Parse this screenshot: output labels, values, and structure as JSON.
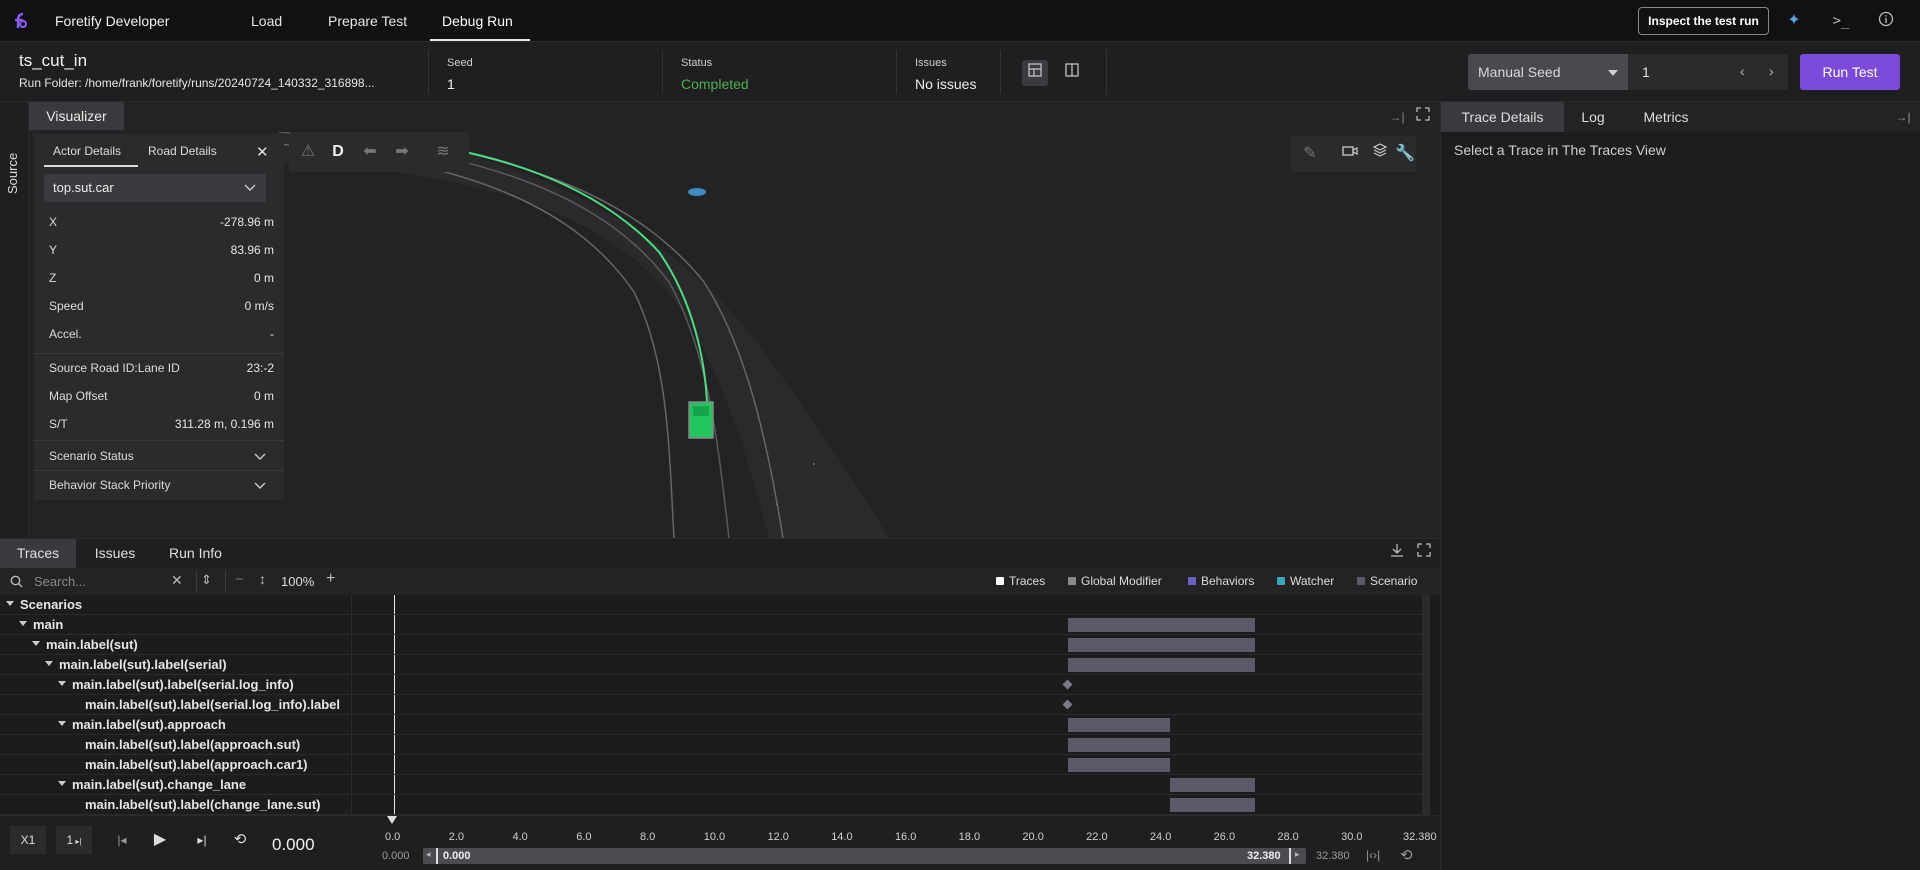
{
  "nav": {
    "app_name": "Foretify Developer",
    "tabs": [
      "Load",
      "Prepare Test",
      "Debug Run"
    ],
    "active_tab": "Debug Run",
    "inspect_button": "Inspect the test run"
  },
  "header": {
    "test_name": "ts_cut_in",
    "run_folder_label": "Run Folder:",
    "run_folder": "/home/frank/foretify/runs/20240724_140332_316898...",
    "seed_label": "Seed",
    "seed_value": "1",
    "status_label": "Status",
    "status_value": "Completed",
    "status_color": "#4caf50",
    "issues_label": "Issues",
    "issues_value": "No issues",
    "seed_mode": "Manual Seed",
    "seed_input": "1",
    "run_button": "Run Test",
    "run_button_color": "#7b4ad8"
  },
  "source_label": "Source",
  "visualizer": {
    "tab": "Visualizer",
    "mode_letter": "D"
  },
  "actor_panel": {
    "tabs": [
      "Actor Details",
      "Road Details"
    ],
    "selected_actor": "top.sut.car",
    "rows": [
      {
        "k": "X",
        "v": "-278.96 m"
      },
      {
        "k": "Y",
        "v": "83.96 m"
      },
      {
        "k": "Z",
        "v": "0 m"
      },
      {
        "k": "Speed",
        "v": "0 m/s"
      },
      {
        "k": "Accel.",
        "v": "-"
      }
    ],
    "rows2": [
      {
        "k": "Source Road ID:Lane ID",
        "v": "23:-2"
      },
      {
        "k": "Map Offset",
        "v": "0 m"
      },
      {
        "k": "S/T",
        "v": "311.28 m, 0.196 m"
      }
    ],
    "sections": [
      "Scenario Status",
      "Behavior Stack Priority"
    ]
  },
  "right_panel": {
    "tabs": [
      "Trace Details",
      "Log",
      "Metrics"
    ],
    "empty_message": "Select a Trace in The Traces View"
  },
  "traces": {
    "tabs": [
      "Traces",
      "Issues",
      "Run Info"
    ],
    "search_placeholder": "Search...",
    "zoom": "100%",
    "legend": [
      {
        "label": "Traces",
        "color": "#ffffff"
      },
      {
        "label": "Global Modifier",
        "color": "#8a8a8a"
      },
      {
        "label": "Behaviors",
        "color": "#6b62c9"
      },
      {
        "label": "Watcher",
        "color": "#3aa6b9"
      },
      {
        "label": "Scenario",
        "color": "#5a5a68"
      }
    ],
    "tree": [
      {
        "label": "Scenarios",
        "depth": 0,
        "expanded": true
      },
      {
        "label": "main",
        "depth": 1,
        "expanded": true
      },
      {
        "label": "main.label(sut)",
        "depth": 2,
        "expanded": true
      },
      {
        "label": "main.label(sut).label(serial)",
        "depth": 3,
        "expanded": true
      },
      {
        "label": "main.label(sut).label(serial.log_info)",
        "depth": 4,
        "expanded": true
      },
      {
        "label": "main.label(sut).label(serial.log_info).label",
        "depth": 5,
        "expanded": false
      },
      {
        "label": "main.label(sut).approach",
        "depth": 4,
        "expanded": true
      },
      {
        "label": "main.label(sut).label(approach.sut)",
        "depth": 5,
        "expanded": false
      },
      {
        "label": "main.label(sut).label(approach.car1)",
        "depth": 5,
        "expanded": false
      },
      {
        "label": "main.label(sut).change_lane",
        "depth": 4,
        "expanded": true
      },
      {
        "label": "main.label(sut).label(change_lane.sut)",
        "depth": 5,
        "expanded": false
      }
    ],
    "spans": [
      null,
      {
        "start": 21.3,
        "end": 27.2
      },
      {
        "start": 21.3,
        "end": 27.2
      },
      {
        "start": 21.3,
        "end": 27.2
      },
      {
        "point": 21.3
      },
      {
        "point": 21.3
      },
      {
        "start": 21.3,
        "end": 24.5
      },
      {
        "start": 21.3,
        "end": 24.5
      },
      {
        "start": 21.3,
        "end": 24.5
      },
      {
        "start": 24.5,
        "end": 27.2
      },
      {
        "start": 24.5,
        "end": 27.2
      }
    ]
  },
  "playback": {
    "speed": "X1",
    "step": "1",
    "current_time": "0.000",
    "ticks": [
      "0.0",
      "2.0",
      "4.0",
      "6.0",
      "8.0",
      "10.0",
      "12.0",
      "14.0",
      "16.0",
      "18.0",
      "20.0",
      "22.0",
      "24.0",
      "26.0",
      "28.0",
      "30.0",
      "32.380"
    ],
    "time_max": 32.38,
    "range_start": "0.000",
    "range_start_inner": "0.000",
    "range_end_inner": "32.380",
    "range_end": "32.380"
  }
}
